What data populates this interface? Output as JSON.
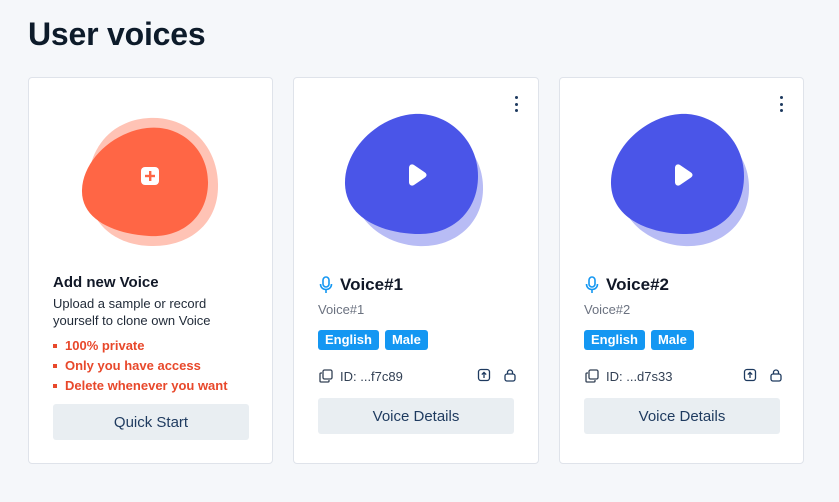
{
  "page": {
    "title": "User voices"
  },
  "add_card": {
    "title": "Add new Voice",
    "description": "Upload a sample or record yourself to clone own Voice",
    "features": [
      "100% private",
      "Only you have access",
      "Delete whenever you want"
    ],
    "button_label": "Quick Start",
    "icon": "plus-icon"
  },
  "voices": [
    {
      "name": "Voice#1",
      "subtitle": "Voice#1",
      "tags": [
        "English",
        "Male"
      ],
      "id_text": "ID: ...f7c89",
      "button_label": "Voice Details"
    },
    {
      "name": "Voice#2",
      "subtitle": "Voice#2",
      "tags": [
        "English",
        "Male"
      ],
      "id_text": "ID: ...d7s33",
      "button_label": "Voice Details"
    }
  ],
  "colors": {
    "orange_blob": "#ff6645",
    "orange_blob_back": "#ffc3b5",
    "blue_blob": "#4a55e8",
    "blue_blob_back": "#b8bcf5",
    "tag_blue": "#1497f2",
    "feature_red": "#e8482b"
  }
}
